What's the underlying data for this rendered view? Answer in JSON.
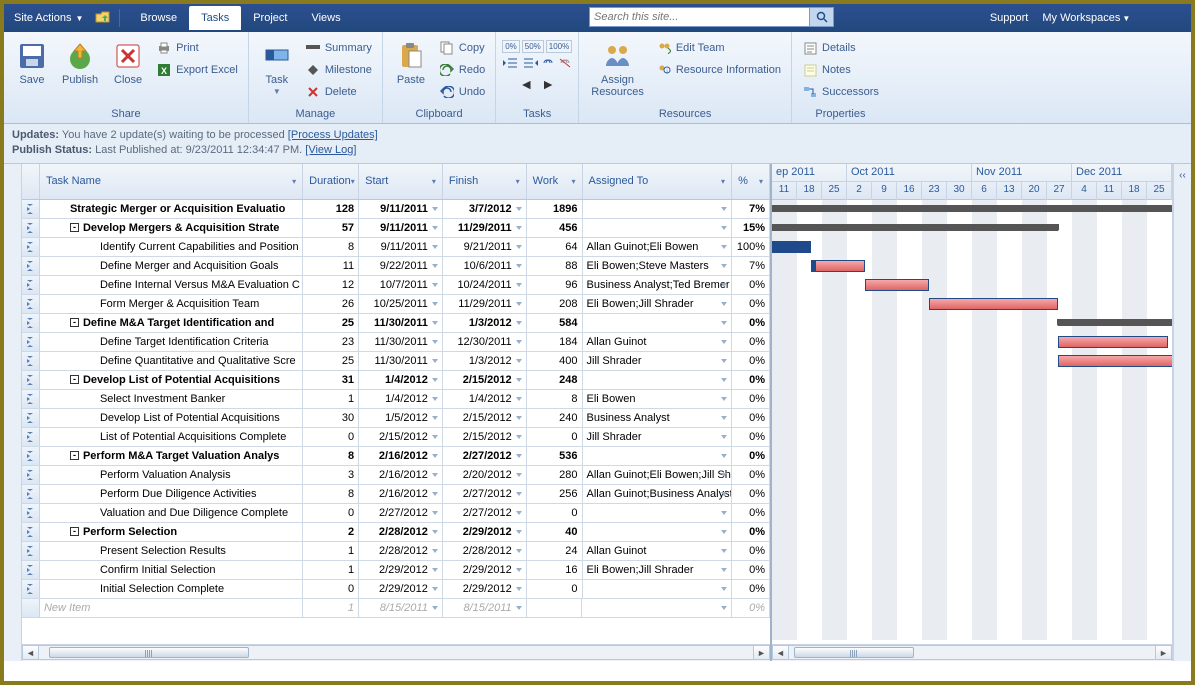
{
  "topbar": {
    "site_actions": "Site Actions",
    "tabs": {
      "browse": "Browse",
      "tasks": "Tasks",
      "project": "Project",
      "views": "Views"
    },
    "search_placeholder": "Search this site...",
    "support": "Support",
    "workspaces": "My Workspaces"
  },
  "ribbon": {
    "share": {
      "title": "Share",
      "save": "Save",
      "publish": "Publish",
      "close": "Close",
      "print": "Print",
      "export": "Export Excel"
    },
    "manage": {
      "title": "Manage",
      "task": "Task",
      "summary": "Summary",
      "milestone": "Milestone",
      "delete": "Delete"
    },
    "clipboard": {
      "title": "Clipboard",
      "paste": "Paste",
      "copy": "Copy",
      "redo": "Redo",
      "undo": "Undo"
    },
    "tasks": {
      "title": "Tasks"
    },
    "resources": {
      "title": "Resources",
      "assign": "Assign\nResources",
      "edit_team": "Edit Team",
      "info": "Resource Information"
    },
    "properties": {
      "title": "Properties",
      "details": "Details",
      "notes": "Notes",
      "successors": "Successors"
    }
  },
  "status": {
    "updates_label": "Updates:",
    "updates_text": "You have 2 update(s) waiting to be processed",
    "updates_link": "[Process Updates]",
    "publish_label": "Publish Status:",
    "publish_text": "Last Published at: 9/23/2011 12:34:47 PM.",
    "publish_link": "[View Log]"
  },
  "columns": {
    "name": "Task Name",
    "duration": "Duration",
    "start": "Start",
    "finish": "Finish",
    "work": "Work",
    "assigned": "Assigned To",
    "pct": "%"
  },
  "gantt": {
    "months": [
      "ep 2011",
      "Oct 2011",
      "Nov 2011",
      "Dec 2011"
    ],
    "days": [
      "11",
      "18",
      "25",
      "2",
      "9",
      "16",
      "23",
      "30",
      "6",
      "13",
      "20",
      "27",
      "4",
      "11",
      "18",
      "25"
    ]
  },
  "rows": [
    {
      "lvl": 0,
      "bold": true,
      "name": "Strategic Merger or Acquisition Evaluatio",
      "dur": "128",
      "start": "9/11/2011",
      "fin": "3/7/2012",
      "work": "1896",
      "asg": "",
      "pct": "7%"
    },
    {
      "lvl": 1,
      "bold": true,
      "tg": "-",
      "name": "Develop Mergers & Acquisition Strate",
      "dur": "57",
      "start": "9/11/2011",
      "fin": "11/29/2011",
      "work": "456",
      "asg": "",
      "pct": "15%"
    },
    {
      "lvl": 2,
      "name": "Identify Current Capabilities and Position",
      "dur": "8",
      "start": "9/11/2011",
      "fin": "9/21/2011",
      "work": "64",
      "asg": "Allan Guinot;Eli Bowen",
      "pct": "100%"
    },
    {
      "lvl": 2,
      "name": "Define Merger and Acquisition Goals",
      "dur": "11",
      "start": "9/22/2011",
      "fin": "10/6/2011",
      "work": "88",
      "asg": "Eli Bowen;Steve Masters",
      "pct": "7%"
    },
    {
      "lvl": 2,
      "name": "Define Internal Versus M&A Evaluation C",
      "dur": "12",
      "start": "10/7/2011",
      "fin": "10/24/2011",
      "work": "96",
      "asg": "Business Analyst;Ted Bremer",
      "pct": "0%"
    },
    {
      "lvl": 2,
      "name": "Form Merger & Acquisition Team",
      "dur": "26",
      "start": "10/25/2011",
      "fin": "11/29/2011",
      "work": "208",
      "asg": "Eli Bowen;Jill Shrader",
      "pct": "0%"
    },
    {
      "lvl": 1,
      "bold": true,
      "tg": "-",
      "name": "Define M&A Target Identification and",
      "dur": "25",
      "start": "11/30/2011",
      "fin": "1/3/2012",
      "work": "584",
      "asg": "",
      "pct": "0%"
    },
    {
      "lvl": 2,
      "name": "Define Target Identification Criteria",
      "dur": "23",
      "start": "11/30/2011",
      "fin": "12/30/2011",
      "work": "184",
      "asg": "Allan Guinot",
      "pct": "0%"
    },
    {
      "lvl": 2,
      "name": "Define Quantitative and Qualitative Scre",
      "dur": "25",
      "start": "11/30/2011",
      "fin": "1/3/2012",
      "work": "400",
      "asg": "Jill Shrader",
      "pct": "0%"
    },
    {
      "lvl": 1,
      "bold": true,
      "tg": "-",
      "name": "Develop List of Potential Acquisitions",
      "dur": "31",
      "start": "1/4/2012",
      "fin": "2/15/2012",
      "work": "248",
      "asg": "",
      "pct": "0%"
    },
    {
      "lvl": 2,
      "name": "Select Investment Banker",
      "dur": "1",
      "start": "1/4/2012",
      "fin": "1/4/2012",
      "work": "8",
      "asg": "Eli Bowen",
      "pct": "0%"
    },
    {
      "lvl": 2,
      "name": "Develop List of Potential Acquisitions",
      "dur": "30",
      "start": "1/5/2012",
      "fin": "2/15/2012",
      "work": "240",
      "asg": "Business Analyst",
      "pct": "0%"
    },
    {
      "lvl": 2,
      "name": "List of Potential Acquisitions Complete",
      "dur": "0",
      "start": "2/15/2012",
      "fin": "2/15/2012",
      "work": "0",
      "asg": "Jill Shrader",
      "pct": "0%"
    },
    {
      "lvl": 1,
      "bold": true,
      "tg": "-",
      "name": "Perform M&A Target Valuation Analys",
      "dur": "8",
      "start": "2/16/2012",
      "fin": "2/27/2012",
      "work": "536",
      "asg": "",
      "pct": "0%"
    },
    {
      "lvl": 2,
      "name": "Perform Valuation Analysis",
      "dur": "3",
      "start": "2/16/2012",
      "fin": "2/20/2012",
      "work": "280",
      "asg": "Allan Guinot;Eli Bowen;Jill Shra",
      "pct": "0%"
    },
    {
      "lvl": 2,
      "name": "Perform Due Diligence Activities",
      "dur": "8",
      "start": "2/16/2012",
      "fin": "2/27/2012",
      "work": "256",
      "asg": "Allan Guinot;Business Analyst;E",
      "pct": "0%"
    },
    {
      "lvl": 2,
      "name": "Valuation and Due Diligence Complete",
      "dur": "0",
      "start": "2/27/2012",
      "fin": "2/27/2012",
      "work": "0",
      "asg": "",
      "pct": "0%"
    },
    {
      "lvl": 1,
      "bold": true,
      "tg": "-",
      "name": "Perform Selection",
      "dur": "2",
      "start": "2/28/2012",
      "fin": "2/29/2012",
      "work": "40",
      "asg": "",
      "pct": "0%"
    },
    {
      "lvl": 2,
      "name": "Present Selection Results",
      "dur": "1",
      "start": "2/28/2012",
      "fin": "2/28/2012",
      "work": "24",
      "asg": "Allan Guinot",
      "pct": "0%"
    },
    {
      "lvl": 2,
      "name": "Confirm Initial Selection",
      "dur": "1",
      "start": "2/29/2012",
      "fin": "2/29/2012",
      "work": "16",
      "asg": "Eli Bowen;Jill Shrader",
      "pct": "0%"
    },
    {
      "lvl": 2,
      "name": "Initial Selection Complete",
      "dur": "0",
      "start": "2/29/2012",
      "fin": "2/29/2012",
      "work": "0",
      "asg": "",
      "pct": "0%"
    }
  ],
  "new_row": {
    "name": "New Item",
    "dur": "1",
    "start": "8/15/2011",
    "fin": "8/15/2011",
    "pct": "0%"
  }
}
